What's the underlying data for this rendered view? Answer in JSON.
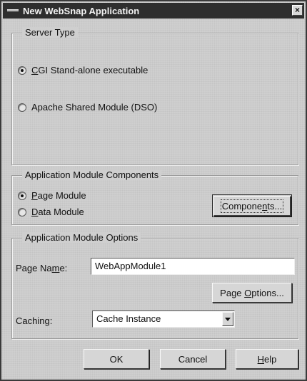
{
  "window": {
    "title": "New WebSnap Application",
    "close_glyph": "×"
  },
  "server_type": {
    "title": "Server Type",
    "options": [
      {
        "label_prefix": "",
        "label_underlined": "C",
        "label_rest": "GI Stand-alone executable",
        "selected": true
      },
      {
        "label_prefix": "",
        "label_underlined": "",
        "label_rest": "Apache Shared Module (DSO)",
        "selected": false
      }
    ]
  },
  "module_components": {
    "title": "Application Module Components",
    "options": [
      {
        "label_underlined": "P",
        "label_rest": "age Module",
        "selected": true
      },
      {
        "label_underlined": "D",
        "label_rest": "ata Module",
        "selected": false
      }
    ],
    "components_button": {
      "label_prefix": "Compone",
      "label_underlined": "n",
      "label_rest": "ts..."
    }
  },
  "module_options": {
    "title": "Application Module Options",
    "page_name_label": {
      "prefix": "Page Na",
      "underlined": "m",
      "rest": "e:"
    },
    "page_name_value": "WebAppModule1",
    "page_options_button": {
      "prefix": "Page ",
      "underlined": "O",
      "rest": "ptions..."
    },
    "caching_label": "Caching:",
    "caching_value": "Cache Instance"
  },
  "buttons": {
    "ok": "OK",
    "cancel": "Cancel",
    "help_underlined": "H",
    "help_rest": "elp"
  }
}
